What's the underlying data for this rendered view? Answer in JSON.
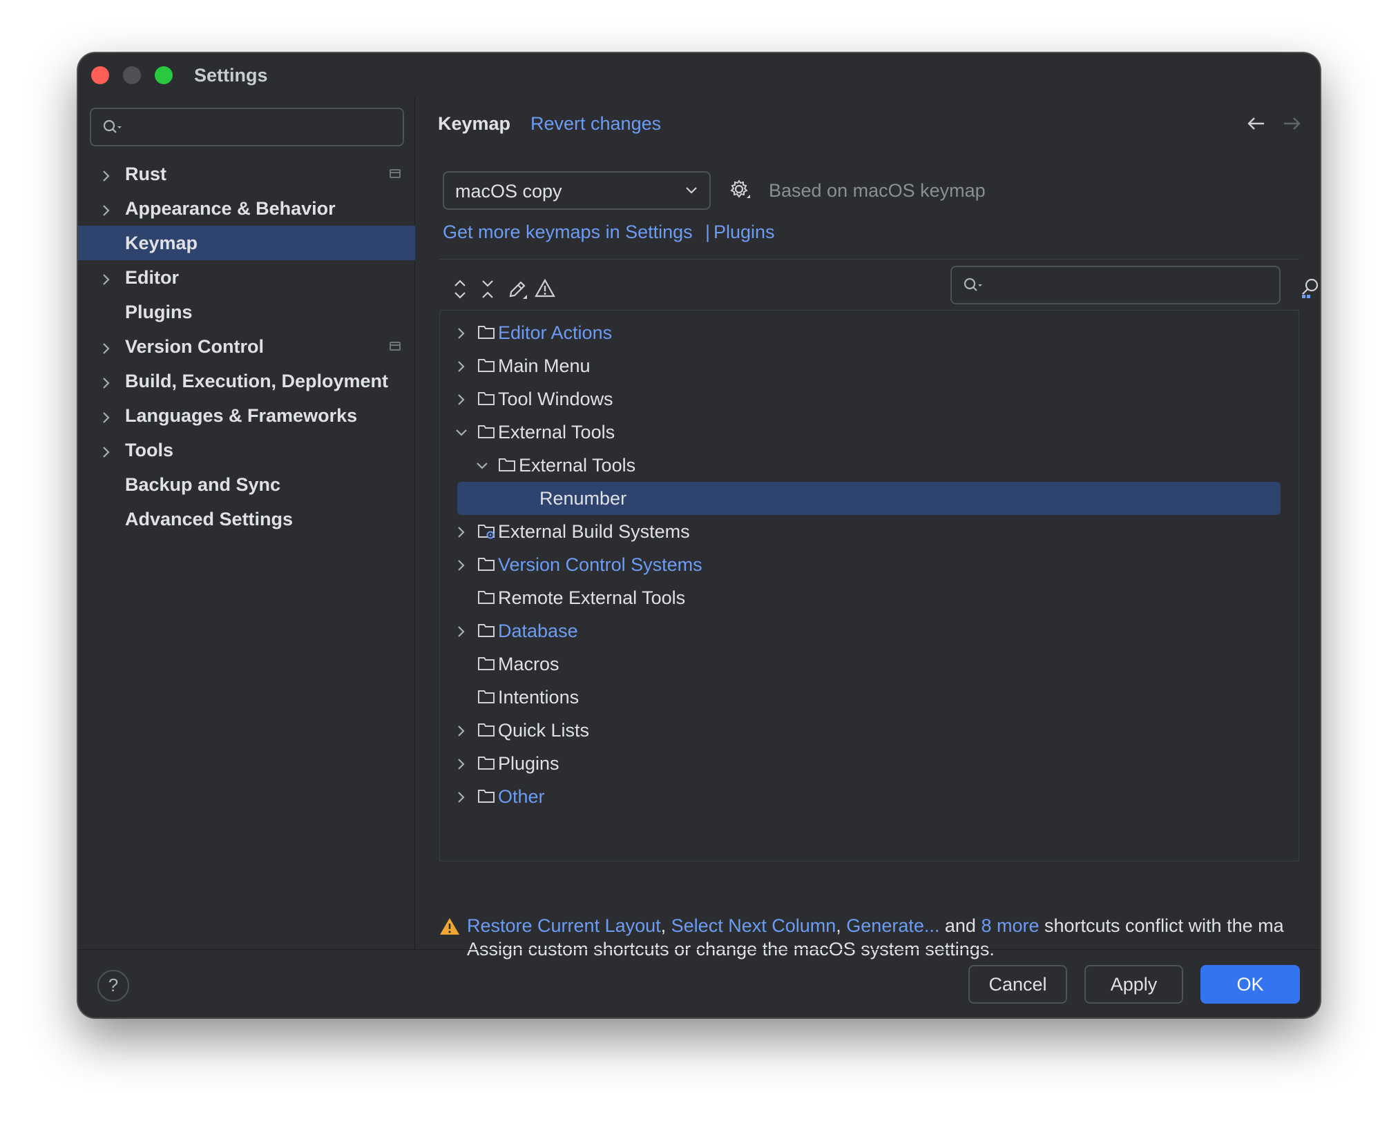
{
  "window": {
    "title": "Settings"
  },
  "sidebar": {
    "search": {
      "placeholder": "",
      "icon": "search-icon"
    },
    "items": [
      {
        "label": "Rust",
        "expandable": true,
        "pinned": true,
        "selected": false
      },
      {
        "label": "Appearance & Behavior",
        "expandable": true,
        "pinned": false,
        "selected": false
      },
      {
        "label": "Keymap",
        "expandable": false,
        "pinned": false,
        "selected": true
      },
      {
        "label": "Editor",
        "expandable": true,
        "pinned": false,
        "selected": false
      },
      {
        "label": "Plugins",
        "expandable": false,
        "pinned": false,
        "selected": false
      },
      {
        "label": "Version Control",
        "expandable": true,
        "pinned": true,
        "selected": false
      },
      {
        "label": "Build, Execution, Deployment",
        "expandable": true,
        "pinned": false,
        "selected": false
      },
      {
        "label": "Languages & Frameworks",
        "expandable": true,
        "pinned": false,
        "selected": false
      },
      {
        "label": "Tools",
        "expandable": true,
        "pinned": false,
        "selected": false
      },
      {
        "label": "Backup and Sync",
        "expandable": false,
        "pinned": false,
        "selected": false
      },
      {
        "label": "Advanced Settings",
        "expandable": false,
        "pinned": false,
        "selected": false
      }
    ]
  },
  "header": {
    "title": "Keymap",
    "revert_link": "Revert changes"
  },
  "keymap": {
    "selected": "macOS copy",
    "based_on": "Based on macOS keymap",
    "more_link": "Get more keymaps in Settings",
    "separator": "|",
    "plugins_link": "Plugins"
  },
  "toolbar": {
    "icons": [
      "expand-all-icon",
      "collapse-all-icon",
      "edit-icon",
      "conflicts-warning-icon"
    ],
    "search_placeholder": ""
  },
  "tree": [
    {
      "label": "Editor Actions",
      "depth": 0,
      "chevron": "right",
      "folder": true,
      "link": true
    },
    {
      "label": "Main Menu",
      "depth": 0,
      "chevron": "right",
      "folder": true,
      "link": false
    },
    {
      "label": "Tool Windows",
      "depth": 0,
      "chevron": "right",
      "folder": true,
      "link": false
    },
    {
      "label": "External Tools",
      "depth": 0,
      "chevron": "down",
      "folder": true,
      "link": false
    },
    {
      "label": "External Tools",
      "depth": 1,
      "chevron": "down",
      "folder": true,
      "link": false
    },
    {
      "label": "Renumber",
      "depth": 2,
      "chevron": "none",
      "folder": false,
      "link": false,
      "selected": true
    },
    {
      "label": "External Build Systems",
      "depth": 0,
      "chevron": "right",
      "folder": true,
      "gear": true,
      "link": false
    },
    {
      "label": "Version Control Systems",
      "depth": 0,
      "chevron": "right",
      "folder": true,
      "link": true
    },
    {
      "label": "Remote External Tools",
      "depth": 0,
      "chevron": "none",
      "folder": true,
      "link": false
    },
    {
      "label": "Database",
      "depth": 0,
      "chevron": "right",
      "folder": true,
      "link": true
    },
    {
      "label": "Macros",
      "depth": 0,
      "chevron": "none",
      "folder": true,
      "link": false
    },
    {
      "label": "Intentions",
      "depth": 0,
      "chevron": "none",
      "folder": true,
      "link": false
    },
    {
      "label": "Quick Lists",
      "depth": 0,
      "chevron": "right",
      "folder": true,
      "link": false
    },
    {
      "label": "Plugins",
      "depth": 0,
      "chevron": "right",
      "folder": true,
      "link": false
    },
    {
      "label": "Other",
      "depth": 0,
      "chevron": "right",
      "folder": true,
      "link": true
    }
  ],
  "conflict": {
    "link1": "Restore Current Layout",
    "comma1": ", ",
    "link2": "Select Next Column",
    "comma2": ", ",
    "link3": "Generate...",
    "and_text": " and ",
    "link4": "8 more",
    "suffix": " shortcuts conflict with the ma",
    "line2": "Assign custom shortcuts or change the macOS system settings."
  },
  "footer": {
    "help": "?",
    "cancel": "Cancel",
    "apply": "Apply",
    "ok": "OK"
  },
  "colors": {
    "background": "#2b2d30",
    "selection": "#2e436e",
    "link": "#6c9cf4",
    "primary_button": "#3574f0",
    "warning": "#f0a732"
  }
}
